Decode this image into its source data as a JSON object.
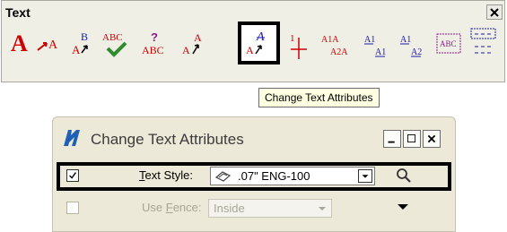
{
  "toolbox": {
    "title": "Text",
    "close_glyph": "×",
    "tools": [
      {
        "name": "place-text-tool",
        "icon": "large-a-icon"
      },
      {
        "name": "place-text-along-element-tool",
        "icon": "arrow-a-icon"
      },
      {
        "name": "edit-text-tool",
        "icon": "a-to-b-icon"
      },
      {
        "name": "spell-checker-tool",
        "icon": "abc-check-icon"
      },
      {
        "name": "display-text-attributes-tool",
        "icon": "abc-question-icon"
      },
      {
        "name": "match-text-attributes-tool",
        "icon": "match-a-icon"
      },
      {
        "name": "change-text-attributes-tool",
        "icon": "change-a-icon",
        "selected": true
      },
      {
        "name": "place-note-tool",
        "icon": "note-one-icon"
      },
      {
        "name": "copy-enlarge-text-tool",
        "icon": "a1a-a2a-icon"
      },
      {
        "name": "copy-increment-text-tool",
        "icon": "a1-a1-icon"
      },
      {
        "name": "increment-text-tool",
        "icon": "a1-a2-icon"
      },
      {
        "name": "text-node-tool",
        "icon": "abc-box-icon"
      },
      {
        "name": "fill-in-enter-data-field-tool",
        "icon": "dotted-box-icon"
      }
    ]
  },
  "tooltip": {
    "text": "Change Text Attributes"
  },
  "dialog": {
    "title": "Change Text Attributes",
    "minimize_glyph": "_",
    "maximize_glyph": "□",
    "close_glyph": "×",
    "rows": [
      {
        "checked": true,
        "label_pre": "",
        "label_accel": "T",
        "label_post": "ext Style:",
        "value": ".07\"  ENG-100",
        "enabled": true
      },
      {
        "checked": false,
        "label_pre": "Use ",
        "label_accel": "F",
        "label_post": "ence:",
        "value": "Inside",
        "enabled": false
      }
    ]
  },
  "colors": {
    "text_red": "#cc0000",
    "text_blue": "#1a1aa6",
    "check_green": "#2e8b2e",
    "toolbar_bg": "#f0efe6",
    "dialog_bg": "#ece9d8",
    "tooltip_bg": "#ffffe1",
    "disabled_text": "#a8a598"
  }
}
